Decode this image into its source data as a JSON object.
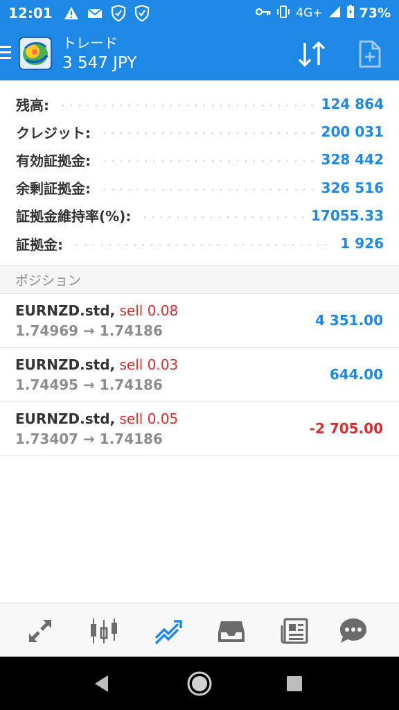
{
  "status_bar": {
    "time": "12:01",
    "network": "4G+",
    "battery": "73%",
    "icons": [
      "warning-icon",
      "mail-icon",
      "shield-check-icon",
      "shield-check-icon",
      "key-icon",
      "vibrate-icon",
      "signal-icon",
      "battery-icon"
    ]
  },
  "app_bar": {
    "title": "トレード",
    "subtitle": "3 547 JPY",
    "icons": [
      "menu-icon",
      "app-logo",
      "sort-icon",
      "new-order-icon"
    ]
  },
  "summary": [
    {
      "label": "残高:",
      "value": "124 864"
    },
    {
      "label": "クレジット:",
      "value": "200 031"
    },
    {
      "label": "有効証拠金:",
      "value": "328 442"
    },
    {
      "label": "余剰証拠金:",
      "value": "326 516"
    },
    {
      "label": "証拠金維持率(%):",
      "value": "17055.33"
    },
    {
      "label": "証拠金:",
      "value": "1 926"
    }
  ],
  "positions_header": "ポジション",
  "positions": [
    {
      "symbol": "EURNZD.std,",
      "direction": "sell 0.08",
      "prices": "1.74969 → 1.74186",
      "profit": "4 351.00"
    },
    {
      "symbol": "EURNZD.std,",
      "direction": "sell 0.03",
      "prices": "1.74495 → 1.74186",
      "profit": "644.00"
    },
    {
      "symbol": "EURNZD.std,",
      "direction": "sell 0.05",
      "prices": "1.73407 → 1.74186",
      "profit": "-2 705.00"
    }
  ],
  "bottom_nav": [
    "quotes-icon",
    "chart-icon",
    "trade-icon",
    "history-icon",
    "news-icon",
    "chat-icon"
  ],
  "colors": {
    "primary": "#1e88e5",
    "loss": "#d32f2f",
    "text": "#333333",
    "muted": "#8c8c8c"
  }
}
